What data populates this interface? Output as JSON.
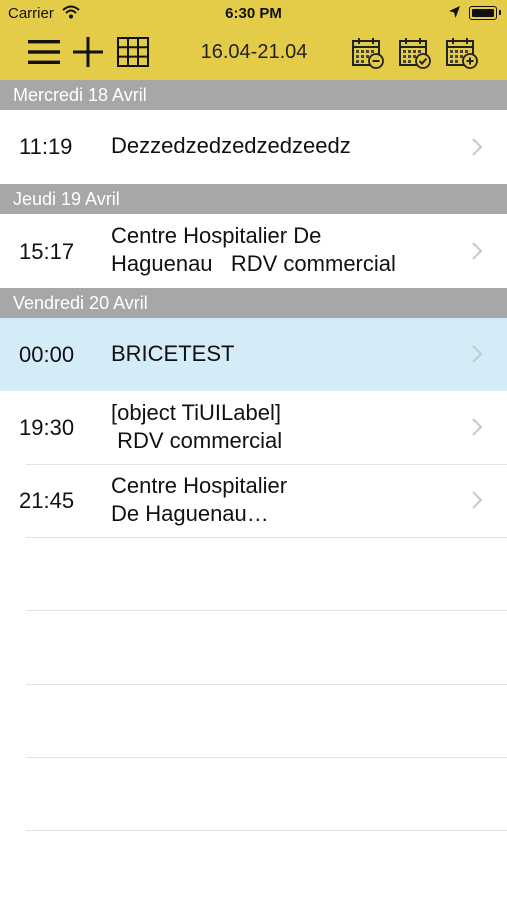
{
  "status_bar": {
    "carrier": "Carrier",
    "time": "6:30 PM"
  },
  "header": {
    "date_range": "16.04-21.04",
    "background_color": "#e5cc48",
    "icons": [
      "menu-icon",
      "add-icon",
      "grid-icon",
      "calendar-minus-icon",
      "calendar-check-icon",
      "calendar-plus-icon"
    ]
  },
  "sections": [
    {
      "label": "Mercredi 18 Avril",
      "items": [
        {
          "time": "11:19",
          "title": "Dezzedzedzedzedzeedz"
        }
      ]
    },
    {
      "label": "Jeudi 19 Avril",
      "items": [
        {
          "time": "15:17",
          "title": "Centre Hospitalier De\nHaguenau   RDV commercial"
        }
      ]
    },
    {
      "label": "Vendredi 20 Avril",
      "items": [
        {
          "time": "00:00",
          "title": "BRICETEST",
          "selected": true
        },
        {
          "time": "19:30",
          "title": "[object TiUILabel]\n RDV commercial"
        },
        {
          "time": "21:45",
          "title": "Centre Hospitalier\nDe Haguenau…"
        }
      ]
    }
  ],
  "colors": {
    "section_bg": "#a7a7a7",
    "selected_row_bg": "#d4ecf7",
    "separator": "#e3e3e3"
  }
}
